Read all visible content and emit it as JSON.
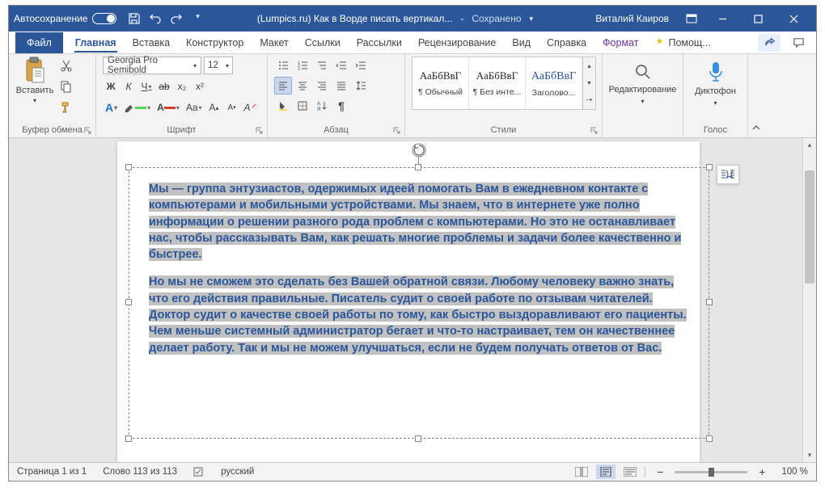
{
  "titlebar": {
    "autosave_label": "Автосохранение",
    "doc_name": "(Lumpics.ru) Как в Ворде писать вертикал...",
    "saved": "Сохранено",
    "user": "Виталий Каиров"
  },
  "tabs": {
    "file": "Файл",
    "home": "Главная",
    "insert": "Вставка",
    "design": "Конструктор",
    "layout": "Макет",
    "references": "Ссылки",
    "mailings": "Рассылки",
    "review": "Рецензирование",
    "view": "Вид",
    "help": "Справка",
    "format": "Формат",
    "tell_me": "Помощ..."
  },
  "ribbon": {
    "clipboard": {
      "label": "Буфер обмена",
      "paste": "Вставить"
    },
    "font": {
      "label": "Шрифт",
      "name": "Georgia Pro Semibold",
      "size": "12",
      "bold": "Ж",
      "italic": "К",
      "underline": "Ч",
      "strike": "ab",
      "sub": "x₂",
      "sup": "x²"
    },
    "paragraph": {
      "label": "Абзац"
    },
    "styles": {
      "label": "Стили",
      "sample": "АаБбВвГ",
      "normal": "¶ Обычный",
      "nospace": "¶ Без инте...",
      "heading1": "Заголово..."
    },
    "editing": {
      "label": "Редактирование"
    },
    "voice": {
      "label": "Голос",
      "dictate": "Диктофон"
    }
  },
  "document": {
    "para1": "Мы — группа энтузиастов, одержимых идеей помогать Вам в ежедневном контакте с компьютерами и мобильными устройствами. Мы знаем, что в интернете уже полно информации о решении разного рода проблем с компьютерами. Но это не останавливает нас, чтобы рассказывать Вам, как решать многие проблемы и задачи более качественно и быстрее.",
    "para2": "Но мы не сможем это сделать без Вашей обратной связи. Любому человеку важно знать, что его действия правильные. Писатель судит о своей работе по отзывам читателей. Доктор судит о качестве своей работы по тому, как быстро выздоравливают его пациенты. Чем меньше системный администратор бегает и что-то настраивает, тем он качественнее делает работу. Так и мы не можем улучшаться, если не будем получать ответов от Вас."
  },
  "statusbar": {
    "page": "Страница 1 из 1",
    "words": "Слово 113 из 113",
    "lang": "русский",
    "zoom": "100 %"
  }
}
